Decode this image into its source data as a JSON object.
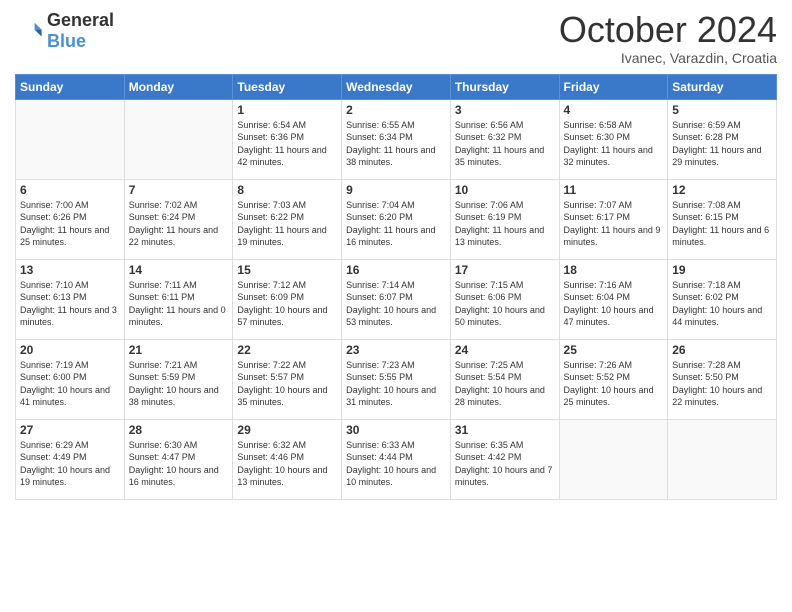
{
  "header": {
    "logo_general": "General",
    "logo_blue": "Blue",
    "title": "October 2024",
    "location": "Ivanec, Varazdin, Croatia"
  },
  "weekdays": [
    "Sunday",
    "Monday",
    "Tuesday",
    "Wednesday",
    "Thursday",
    "Friday",
    "Saturday"
  ],
  "weeks": [
    [
      {
        "day": "",
        "info": ""
      },
      {
        "day": "",
        "info": ""
      },
      {
        "day": "1",
        "info": "Sunrise: 6:54 AM\nSunset: 6:36 PM\nDaylight: 11 hours and 42 minutes."
      },
      {
        "day": "2",
        "info": "Sunrise: 6:55 AM\nSunset: 6:34 PM\nDaylight: 11 hours and 38 minutes."
      },
      {
        "day": "3",
        "info": "Sunrise: 6:56 AM\nSunset: 6:32 PM\nDaylight: 11 hours and 35 minutes."
      },
      {
        "day": "4",
        "info": "Sunrise: 6:58 AM\nSunset: 6:30 PM\nDaylight: 11 hours and 32 minutes."
      },
      {
        "day": "5",
        "info": "Sunrise: 6:59 AM\nSunset: 6:28 PM\nDaylight: 11 hours and 29 minutes."
      }
    ],
    [
      {
        "day": "6",
        "info": "Sunrise: 7:00 AM\nSunset: 6:26 PM\nDaylight: 11 hours and 25 minutes."
      },
      {
        "day": "7",
        "info": "Sunrise: 7:02 AM\nSunset: 6:24 PM\nDaylight: 11 hours and 22 minutes."
      },
      {
        "day": "8",
        "info": "Sunrise: 7:03 AM\nSunset: 6:22 PM\nDaylight: 11 hours and 19 minutes."
      },
      {
        "day": "9",
        "info": "Sunrise: 7:04 AM\nSunset: 6:20 PM\nDaylight: 11 hours and 16 minutes."
      },
      {
        "day": "10",
        "info": "Sunrise: 7:06 AM\nSunset: 6:19 PM\nDaylight: 11 hours and 13 minutes."
      },
      {
        "day": "11",
        "info": "Sunrise: 7:07 AM\nSunset: 6:17 PM\nDaylight: 11 hours and 9 minutes."
      },
      {
        "day": "12",
        "info": "Sunrise: 7:08 AM\nSunset: 6:15 PM\nDaylight: 11 hours and 6 minutes."
      }
    ],
    [
      {
        "day": "13",
        "info": "Sunrise: 7:10 AM\nSunset: 6:13 PM\nDaylight: 11 hours and 3 minutes."
      },
      {
        "day": "14",
        "info": "Sunrise: 7:11 AM\nSunset: 6:11 PM\nDaylight: 11 hours and 0 minutes."
      },
      {
        "day": "15",
        "info": "Sunrise: 7:12 AM\nSunset: 6:09 PM\nDaylight: 10 hours and 57 minutes."
      },
      {
        "day": "16",
        "info": "Sunrise: 7:14 AM\nSunset: 6:07 PM\nDaylight: 10 hours and 53 minutes."
      },
      {
        "day": "17",
        "info": "Sunrise: 7:15 AM\nSunset: 6:06 PM\nDaylight: 10 hours and 50 minutes."
      },
      {
        "day": "18",
        "info": "Sunrise: 7:16 AM\nSunset: 6:04 PM\nDaylight: 10 hours and 47 minutes."
      },
      {
        "day": "19",
        "info": "Sunrise: 7:18 AM\nSunset: 6:02 PM\nDaylight: 10 hours and 44 minutes."
      }
    ],
    [
      {
        "day": "20",
        "info": "Sunrise: 7:19 AM\nSunset: 6:00 PM\nDaylight: 10 hours and 41 minutes."
      },
      {
        "day": "21",
        "info": "Sunrise: 7:21 AM\nSunset: 5:59 PM\nDaylight: 10 hours and 38 minutes."
      },
      {
        "day": "22",
        "info": "Sunrise: 7:22 AM\nSunset: 5:57 PM\nDaylight: 10 hours and 35 minutes."
      },
      {
        "day": "23",
        "info": "Sunrise: 7:23 AM\nSunset: 5:55 PM\nDaylight: 10 hours and 31 minutes."
      },
      {
        "day": "24",
        "info": "Sunrise: 7:25 AM\nSunset: 5:54 PM\nDaylight: 10 hours and 28 minutes."
      },
      {
        "day": "25",
        "info": "Sunrise: 7:26 AM\nSunset: 5:52 PM\nDaylight: 10 hours and 25 minutes."
      },
      {
        "day": "26",
        "info": "Sunrise: 7:28 AM\nSunset: 5:50 PM\nDaylight: 10 hours and 22 minutes."
      }
    ],
    [
      {
        "day": "27",
        "info": "Sunrise: 6:29 AM\nSunset: 4:49 PM\nDaylight: 10 hours and 19 minutes."
      },
      {
        "day": "28",
        "info": "Sunrise: 6:30 AM\nSunset: 4:47 PM\nDaylight: 10 hours and 16 minutes."
      },
      {
        "day": "29",
        "info": "Sunrise: 6:32 AM\nSunset: 4:46 PM\nDaylight: 10 hours and 13 minutes."
      },
      {
        "day": "30",
        "info": "Sunrise: 6:33 AM\nSunset: 4:44 PM\nDaylight: 10 hours and 10 minutes."
      },
      {
        "day": "31",
        "info": "Sunrise: 6:35 AM\nSunset: 4:42 PM\nDaylight: 10 hours and 7 minutes."
      },
      {
        "day": "",
        "info": ""
      },
      {
        "day": "",
        "info": ""
      }
    ]
  ]
}
